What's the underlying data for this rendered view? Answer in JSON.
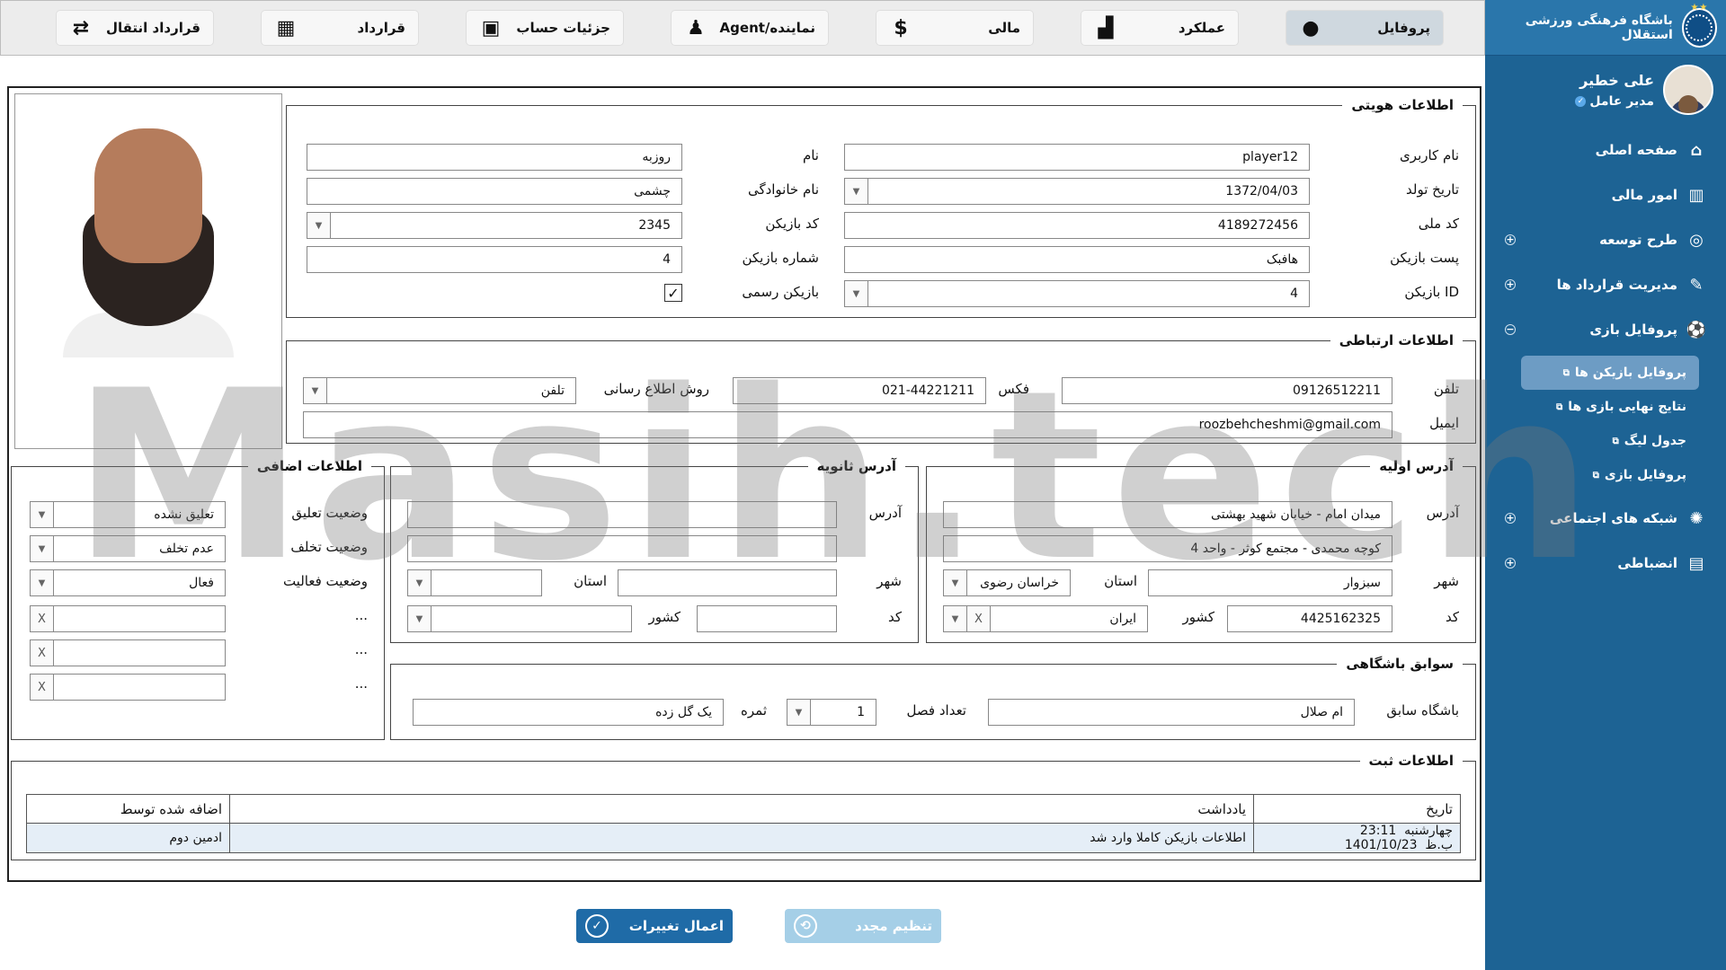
{
  "sidebar": {
    "brand_name": "باشگاه فرهنگی ورزشی استقلال",
    "brand_stars": "★★",
    "user_name": "علی خطیر",
    "user_role": "مدیر عامل",
    "verified": "✓",
    "items": [
      {
        "label": "صفحه اصلی",
        "icon": "⌂"
      },
      {
        "label": "امور مالی",
        "icon": "▥"
      },
      {
        "label": "طرح توسعه",
        "icon": "◎",
        "expander": "+"
      },
      {
        "label": "مدیریت قرارداد ها",
        "icon": "✎",
        "expander": "+"
      },
      {
        "label": "پروفایل بازی",
        "icon": "⚽",
        "expander": "−"
      },
      {
        "label": "شبکه های اجتماعی",
        "icon": "✺",
        "expander": "+"
      },
      {
        "label": "انضباطی",
        "icon": "▤",
        "expander": "+"
      }
    ],
    "sub_items": [
      {
        "label": "پروفایل بازیکن ها",
        "ext": "⧉"
      },
      {
        "label": "نتایج نهایی بازی ها",
        "ext": "⧉"
      },
      {
        "label": "جدول لیگ",
        "ext": "⧉"
      },
      {
        "label": "پروفایل بازی",
        "ext": "⧉"
      }
    ]
  },
  "tabs": [
    {
      "label": "پروفایل",
      "icon": "●"
    },
    {
      "label": "عملکرد",
      "icon": "▟"
    },
    {
      "label": "مالی",
      "icon": "$"
    },
    {
      "label": "نماینده/Agent",
      "icon": "♟"
    },
    {
      "label": "جزئیات حساب",
      "icon": "▣"
    },
    {
      "label": "قرارداد",
      "icon": "▦"
    },
    {
      "label": "قرارداد انتقال",
      "icon": "⇄"
    }
  ],
  "identity": {
    "legend": "اطلاعات هویتی",
    "username_label": "نام کاربری",
    "username": "player12",
    "first_label": "نام",
    "first": "روزبه",
    "birth_label": "تاریخ تولد",
    "birth": "1372/04/03",
    "last_label": "نام خانوادگی",
    "last": "چشمی",
    "national_label": "کد ملی",
    "national": "4189272456",
    "code_label": "کد بازیکن",
    "code": "2345",
    "post_label": "پست بازیکن",
    "post": "هافبک",
    "number_label": "شماره بازیکن",
    "number": "4",
    "id_label": "ID بازیکن",
    "id": "4",
    "official_label": "بازیکن رسمی",
    "official_mark": "✓"
  },
  "contact": {
    "legend": "اطلاعات ارتباطی",
    "phone_label": "تلفن",
    "phone": "09126512211",
    "fax_label": "فکس",
    "fax": "021-44221211",
    "method_label": "روش اطلاع رسانی",
    "method": "تلفن",
    "email_label": "ایمیل",
    "email": "roozbehcheshmi@gmail.com"
  },
  "address1": {
    "legend": "آدرس اولیه",
    "addr_label": "آدرس",
    "line1": "میدان امام - خیابان شهید بهشتی",
    "line2": "کوچه محمدی - مجتمع کوثر - واحد 4",
    "city_label": "شهر",
    "city": "سبزوار",
    "province_label": "استان",
    "province": "خراسان رضوی",
    "code_label": "کد",
    "code": "4425162325",
    "country_label": "کشور",
    "country": "ایران"
  },
  "address2": {
    "legend": "آدرس ثانویه",
    "addr_label": "آدرس",
    "city_label": "شهر",
    "province_label": "استان",
    "code_label": "کد",
    "country_label": "کشور"
  },
  "extra": {
    "legend": "اطلاعات اضافی",
    "suspend_label": "وضعیت تعلیق",
    "suspend": "تعلیق نشده",
    "violation_label": "وضعیت تخلف",
    "violation": "عدم تخلف",
    "activity_label": "وضعیت فعالیت",
    "activity": "فعال",
    "more": "...",
    "clear": "X"
  },
  "history": {
    "legend": "سوابق باشگاهی",
    "club_label": "باشگاه سابق",
    "club": "ام صلال",
    "seasons_label": "تعداد فصل",
    "seasons": "1",
    "result_label": "ثمره",
    "result": "یک گل زده"
  },
  "registry": {
    "legend": "اطلاعات ثبت",
    "headers": [
      "تاریخ",
      "یادداشت",
      "اضافه شده توسط"
    ],
    "row": {
      "day": "چهارشنبه",
      "time": "23:11 ب.ظ",
      "date": "1401/10/23",
      "note": "اطلاعات بازیکن کاملا وارد شد",
      "by": "ادمین دوم"
    }
  },
  "buttons": {
    "apply": "اعمال تغییرات",
    "apply_icon": "✓",
    "reset": "تنظیم مجدد",
    "reset_icon": "⟲"
  },
  "watermark": "Masih.tech",
  "dropdown_arrow": "▼",
  "colors": {
    "sidebar": "#1d6394",
    "apply": "#1f6ba7",
    "reset": "#a5cfe7"
  }
}
